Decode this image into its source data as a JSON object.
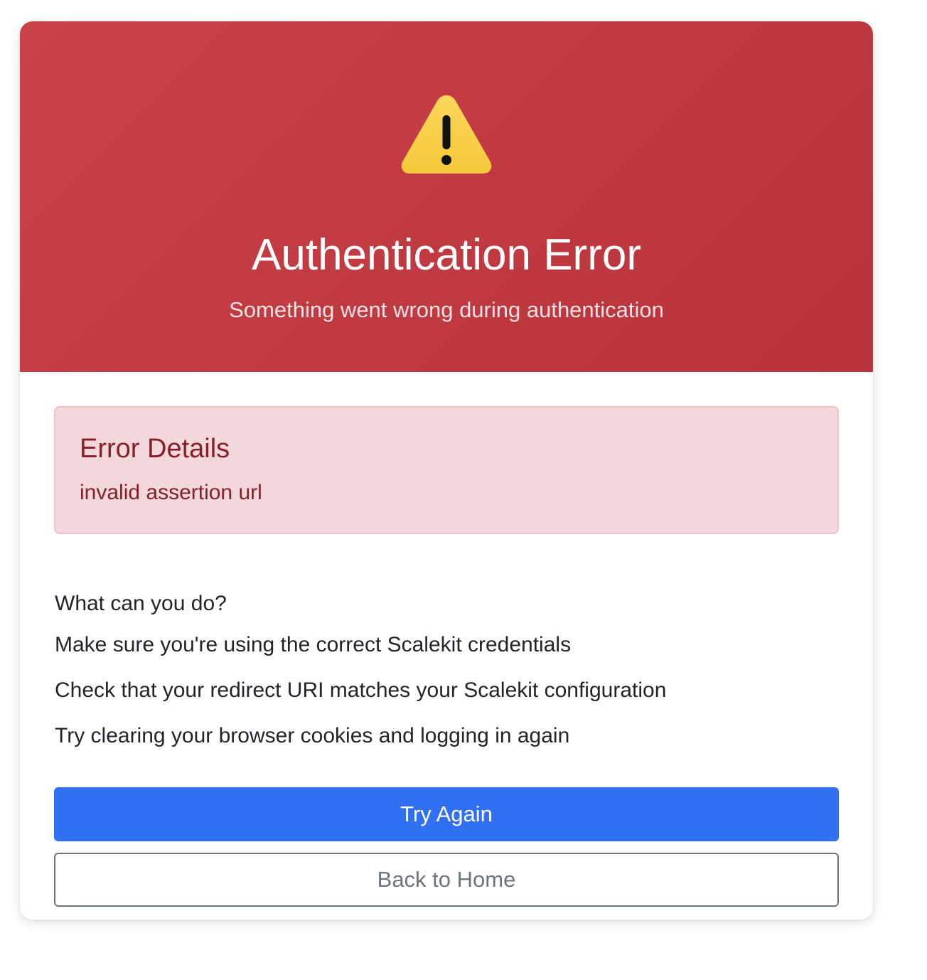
{
  "header": {
    "icon": "warning-icon",
    "title": "Authentication Error",
    "subtitle": "Something went wrong during authentication"
  },
  "error_details": {
    "title": "Error Details",
    "message": "invalid assertion url"
  },
  "help": {
    "heading": "What can you do?",
    "items": [
      "Make sure you're using the correct Scalekit credentials",
      "Check that your redirect URI matches your Scalekit configuration",
      "Try clearing your browser cookies and logging in again"
    ]
  },
  "actions": {
    "try_again_label": "Try Again",
    "back_home_label": "Back to Home"
  },
  "colors": {
    "header_red": "#c0393f",
    "error_text": "#842029",
    "error_bg": "#f3d7db",
    "primary_blue": "#316ff4",
    "secondary_gray": "#6c757d"
  }
}
